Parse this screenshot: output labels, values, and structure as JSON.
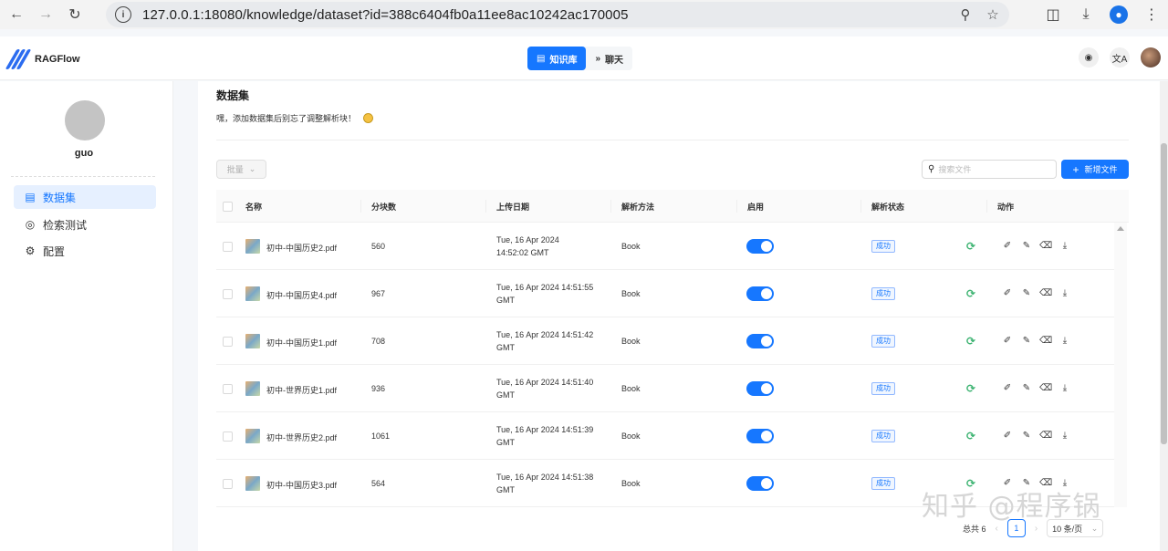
{
  "browser": {
    "url": "127.0.0.1:18080/knowledge/dataset?id=388c6404fb0a11ee8ac10242ac170005",
    "profile_initial": "●"
  },
  "header": {
    "app_name": "RAGFlow",
    "tabs": [
      {
        "label": "知识库",
        "active": true
      },
      {
        "label": "聊天",
        "active": false
      }
    ],
    "lang_label": "文A"
  },
  "sidebar": {
    "user_name": "guo",
    "items": [
      {
        "label": "数据集",
        "icon": "document-icon",
        "active": true
      },
      {
        "label": "检索测试",
        "icon": "target-icon",
        "active": false
      },
      {
        "label": "配置",
        "icon": "gear-icon",
        "active": false
      }
    ]
  },
  "main": {
    "title": "数据集",
    "tip": "嘿，添加数据集后别忘了调整解析块！",
    "bulk_label": "批量",
    "search_placeholder": "搜索文件",
    "add_label": "新增文件",
    "columns": [
      "名称",
      "分块数",
      "上传日期",
      "解析方法",
      "启用",
      "解析状态",
      "动作"
    ],
    "rows": [
      {
        "name": "初中-中国历史2.pdf",
        "chunks": "560",
        "date1": "Tue, 16 Apr 2024",
        "date2": "14:52:02 GMT",
        "method": "Book",
        "status": "成功"
      },
      {
        "name": "初中-中国历史4.pdf",
        "chunks": "967",
        "date1": "Tue, 16 Apr 2024 14:51:55",
        "date2": "GMT",
        "method": "Book",
        "status": "成功"
      },
      {
        "name": "初中-中国历史1.pdf",
        "chunks": "708",
        "date1": "Tue, 16 Apr 2024 14:51:42",
        "date2": "GMT",
        "method": "Book",
        "status": "成功"
      },
      {
        "name": "初中-世界历史1.pdf",
        "chunks": "936",
        "date1": "Tue, 16 Apr 2024 14:51:40",
        "date2": "GMT",
        "method": "Book",
        "status": "成功"
      },
      {
        "name": "初中-世界历史2.pdf",
        "chunks": "1061",
        "date1": "Tue, 16 Apr 2024 14:51:39",
        "date2": "GMT",
        "method": "Book",
        "status": "成功"
      },
      {
        "name": "初中-中国历史3.pdf",
        "chunks": "564",
        "date1": "Tue, 16 Apr 2024 14:51:38",
        "date2": "GMT",
        "method": "Book",
        "status": "成功"
      }
    ],
    "pagination": {
      "total": "总共 6",
      "current": "1",
      "page_size": "10 条/页"
    }
  },
  "watermark": "知乎 @程序锅",
  "colors": {
    "accent": "#1677ff",
    "success": "#3cb371"
  }
}
